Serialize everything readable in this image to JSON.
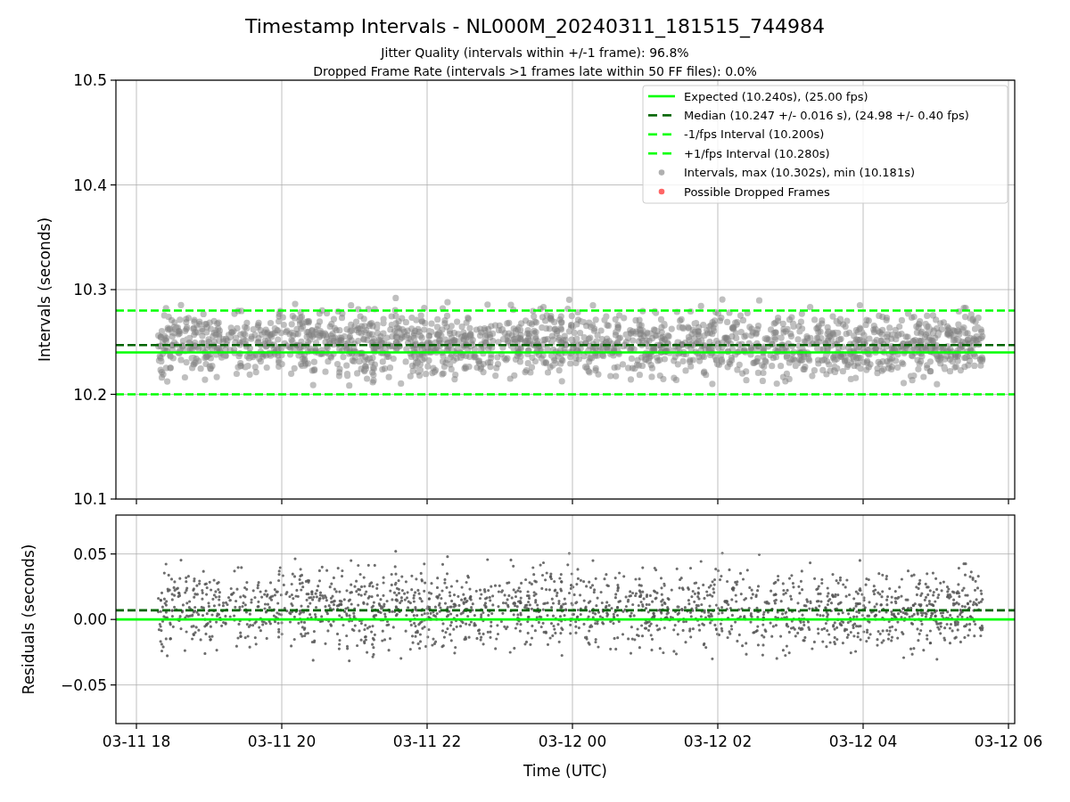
{
  "figure": {
    "title": "Timestamp Intervals - NL000M_20240311_181515_744984",
    "subtitles": [
      "Jitter Quality (intervals within +/-1 frame): 96.8%",
      "Dropped Frame Rate (intervals >1 frames late within 50 FF files): 0.0%"
    ]
  },
  "intervals_panel": {
    "legend": [
      {
        "label": "Expected (10.240s), (25.00 fps)",
        "kind": "line",
        "color": "#00ff00"
      },
      {
        "label": "Median (10.247 +/- 0.016 s), (24.98 +/- 0.40 fps)",
        "kind": "dashed",
        "color": "#006400"
      },
      {
        "label": "-1/fps Interval (10.200s)",
        "kind": "dashed",
        "color": "#00ff00"
      },
      {
        "label": "+1/fps Interval (10.280s)",
        "kind": "dashed",
        "color": "#00ff00"
      },
      {
        "label": "Intervals, max (10.302s), min (10.181s)",
        "kind": "marker",
        "color": "#b0b0b0"
      },
      {
        "label": "Possible Dropped Frames",
        "kind": "marker",
        "color": "#ff6666"
      }
    ],
    "chart_data": {
      "type": "line",
      "ylabel": "Intervals (seconds)",
      "grid": true,
      "categories": [
        null,
        null,
        null,
        null,
        null,
        null,
        null
      ],
      "ylim": [
        10.1,
        10.5
      ],
      "yticks": [
        {
          "value": 10.1,
          "label": "10.1"
        },
        {
          "value": 10.2,
          "label": "10.2"
        },
        {
          "value": 10.3,
          "label": "10.3"
        },
        {
          "value": 10.4,
          "label": "10.4"
        },
        {
          "value": 10.5,
          "label": "10.5"
        }
      ],
      "ref_lines": [
        {
          "axis": "y",
          "value": 10.24,
          "color": "#00ff00",
          "line_style": "solid"
        },
        {
          "axis": "y",
          "value": 10.247,
          "color": "#006400",
          "line_style": "dashed"
        },
        {
          "axis": "y",
          "value": 10.2,
          "color": "#00ff00",
          "line_style": "dashed"
        },
        {
          "axis": "y",
          "value": 10.28,
          "color": "#00ff00",
          "line_style": "dashed"
        }
      ]
    }
  },
  "residuals_panel": {
    "chart_data": {
      "type": "line",
      "xlabel": "Time (UTC)",
      "ylabel": "Residuals (seconds)",
      "grid": true,
      "categories": [
        "03-11 18",
        "03-11 20",
        "03-11 22",
        "03-12 00",
        "03-12 02",
        "03-12 04",
        "03-12 06"
      ],
      "ylim": [
        -0.0795,
        0.0797
      ],
      "yticks": [
        {
          "value": -0.05,
          "label": "−0.05"
        },
        {
          "value": 0,
          "label": "0.00"
        },
        {
          "value": 0.05,
          "label": "0.05"
        }
      ],
      "ref_lines": [
        {
          "axis": "y",
          "value": 0,
          "color": "#00ff00",
          "line_style": "solid"
        },
        {
          "axis": "y",
          "value": 0.007,
          "color": "#006400",
          "line_style": "dashed"
        }
      ]
    }
  }
}
